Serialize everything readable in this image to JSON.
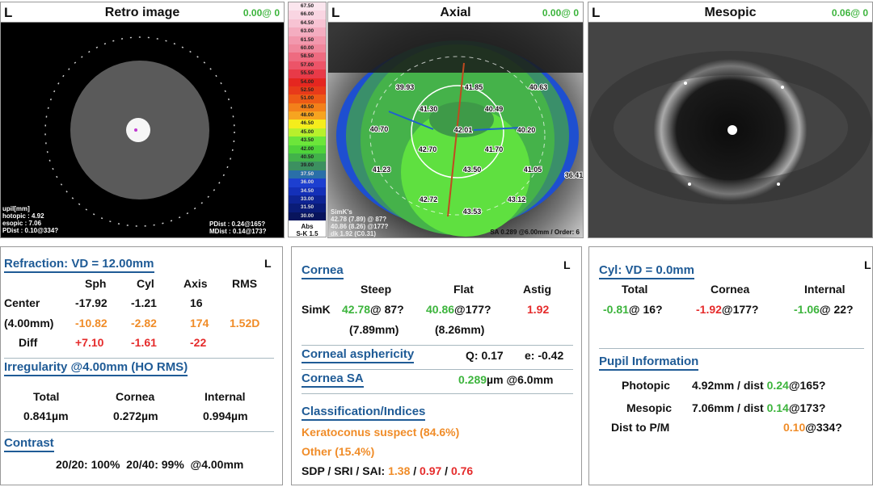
{
  "eye": "L",
  "retro": {
    "title": "Retro image",
    "value": "0.00@ 0",
    "pupil_label": "upil[mm]",
    "photopic": "hotopic : 4.92",
    "mesopic": "esopic : 7.06",
    "pdist_left": "PDist : 0.10@334?",
    "pdist": "PDist : 0.24@165?",
    "mdist": "MDist : 0.14@173?"
  },
  "scale": {
    "values": [
      "67.50",
      "66.00",
      "64.50",
      "63.00",
      "61.50",
      "60.00",
      "58.50",
      "57.00",
      "55.50",
      "54.00",
      "52.50",
      "51.00",
      "49.50",
      "48.00",
      "46.50",
      "45.00",
      "43.50",
      "42.00",
      "40.50",
      "39.00",
      "37.50",
      "36.00",
      "34.50",
      "33.00",
      "31.50",
      "30.00"
    ],
    "colors": [
      "#fbe6ee",
      "#f9d5e2",
      "#f7c3d3",
      "#f4adc0",
      "#f298ad",
      "#f0879c",
      "#ee6b80",
      "#ec5468",
      "#e83a48",
      "#e52620",
      "#e83a1a",
      "#ee5a16",
      "#f3801a",
      "#f6a420",
      "#f5ed1c",
      "#b8f02c",
      "#6ce63a",
      "#4fd33a",
      "#42b24a",
      "#3c9060",
      "#2a6fa8",
      "#1d3fd0",
      "#1430b8",
      "#0e2494",
      "#0a1c78",
      "#08145c"
    ],
    "mode": "Abs",
    "step": "S-K 1.5"
  },
  "axial": {
    "title": "Axial",
    "value": "0.00@ 0",
    "labels": [
      "39.93",
      "41.85",
      "40.63",
      "41.30",
      "40.49",
      "40.70",
      "42.01",
      "40.20",
      "42.70",
      "41.70",
      "41.23",
      "43.50",
      "41.05",
      "36.41",
      "42.72",
      "43.12",
      "43.53"
    ],
    "simk_title": "SimK's",
    "simk_lines": [
      "42.78 (7.89) @ 87?",
      "40.86 (8.26) @177?",
      "dk 1.92 (C0.31)"
    ],
    "sa_text": "SA 0.289 @6.00mm / Order: 6"
  },
  "mesopic": {
    "title": "Mesopic",
    "value": "0.06@ 0"
  },
  "refraction": {
    "title": "Refraction: VD = 12.00mm",
    "eye": "L",
    "headers": [
      "Sph",
      "Cyl",
      "Axis",
      "RMS"
    ],
    "rows": [
      {
        "label": "Center",
        "values": [
          "-17.92",
          "-1.21",
          "16",
          ""
        ]
      },
      {
        "label": "(4.00mm)",
        "values": [
          "-10.82",
          "-2.82",
          "174",
          "1.52D"
        ]
      },
      {
        "label": "Diff",
        "values": [
          "+7.10",
          "-1.61",
          "-22",
          ""
        ]
      }
    ]
  },
  "irregularity": {
    "title": "Irregularity @4.00mm (HO RMS)",
    "headers": [
      "Total",
      "Cornea",
      "Internal"
    ],
    "values": [
      "0.841µm",
      "0.272µm",
      "0.994µm"
    ]
  },
  "contrast": {
    "title": "Contrast",
    "text": "20/20: 100%  20/40: 99%  @4.00mm"
  },
  "cornea": {
    "title": "Cornea",
    "eye": "L",
    "headers": [
      "Steep",
      "Flat",
      "Astig"
    ],
    "simk_label": "SimK",
    "steep_val": "42.78",
    "steep_axis": "@ 87?",
    "flat_val": "40.86",
    "flat_axis": "@177?",
    "astig": "1.92",
    "steep_mm": "(7.89mm)",
    "flat_mm": "(8.26mm)"
  },
  "asphericity": {
    "title": "Corneal asphericity",
    "q": "Q: 0.17",
    "e": "e: -0.42"
  },
  "cornea_sa": {
    "title": "Cornea SA",
    "value": "0.289",
    "unit": "µm @6.0mm"
  },
  "classification": {
    "title": "Classification/Indices",
    "line1": "Keratoconus suspect (84.6%)",
    "line2": "Other (15.4%)",
    "indices_label": "SDP / SRI / SAI: ",
    "sdp": "1.38",
    "sri": "0.97",
    "sai": "0.76",
    "sep": " / "
  },
  "cyl": {
    "title": "Cyl: VD = 0.0mm",
    "eye": "L",
    "headers": [
      "Total",
      "Cornea",
      "Internal"
    ],
    "total_val": "-0.81",
    "total_axis": "@ 16?",
    "cornea_val": "-1.92",
    "cornea_axis": "@177?",
    "internal_val": "-1.06",
    "internal_axis": "@ 22?"
  },
  "pupil": {
    "title": "Pupil Information",
    "photopic_label": "Photopic",
    "photopic_mm": "4.92mm / dist ",
    "photopic_dist": "0.24",
    "photopic_axis": "@165?",
    "mesopic_label": "Mesopic",
    "mesopic_mm": "7.06mm / dist ",
    "mesopic_dist": "0.14",
    "mesopic_axis": "@173?",
    "pm_label": "Dist to P/M",
    "pm_dist": "0.10",
    "pm_axis": "@334?"
  }
}
